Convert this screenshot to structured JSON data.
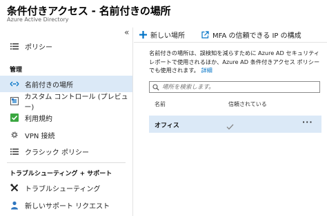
{
  "header": {
    "title": "条件付きアクセス - 名前付きの場所",
    "subtitle": "Azure Active Directory"
  },
  "sidebar": {
    "collapse_glyph": "«",
    "items": [
      {
        "label": "ポリシー"
      },
      {
        "label": "名前付きの場所"
      },
      {
        "label": "カスタム コントロール (プレビュー)"
      },
      {
        "label": "利用規約"
      },
      {
        "label": "VPN 接続"
      },
      {
        "label": "クラシック ポリシー"
      },
      {
        "label": "トラブルシューティング"
      },
      {
        "label": "新しいサポート リクエスト"
      }
    ],
    "sections": {
      "manage": "管理",
      "support": "トラブルシューティング + サポート"
    }
  },
  "toolbar": {
    "new_location": "新しい場所",
    "mfa_config": "MFA の信頼できる IP の構成"
  },
  "main": {
    "description": "名前付きの場所は、誤検知を減らすために Azure AD セキュリティ レポートで使用されるほか、Azure AD 条件付きアクセス ポリシーでも使用されます。",
    "details_link": "詳細",
    "search_placeholder": "場所を検索します。",
    "columns": {
      "name": "名前",
      "trusted": "信頼されている"
    },
    "rows": [
      {
        "name": "オフィス",
        "trusted_icon": "checkmark-icon",
        "more": "···"
      }
    ]
  },
  "colors": {
    "accent": "#0072c6",
    "selected": "#dbe9f7"
  }
}
